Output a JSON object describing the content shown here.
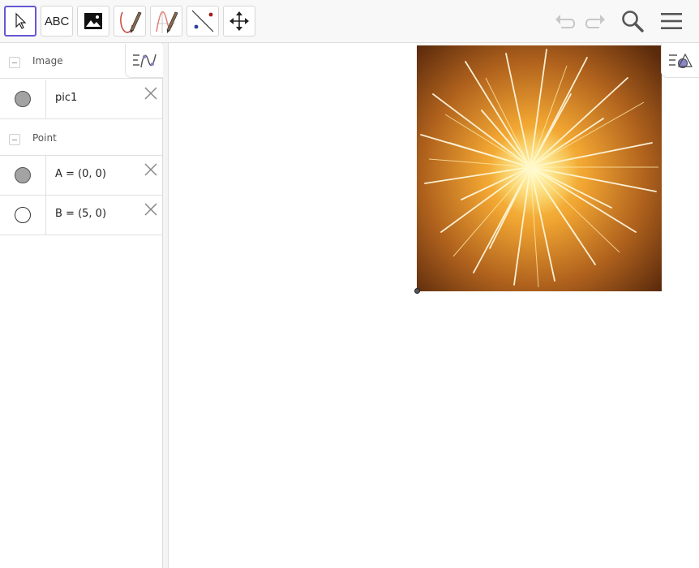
{
  "toolbar": {
    "tools": [
      {
        "name": "move-tool",
        "icon": "cursor-arrow-icon"
      },
      {
        "name": "text-tool",
        "label": "ABC"
      },
      {
        "name": "image-tool",
        "icon": "image-icon"
      },
      {
        "name": "pen-tool",
        "icon": "pen-icon"
      },
      {
        "name": "freehand-function-tool",
        "icon": "function-pen-icon"
      },
      {
        "name": "point-on-line-tool",
        "icon": "line-points-icon"
      },
      {
        "name": "move-graphics-view-tool",
        "icon": "move-arrows-icon"
      }
    ],
    "undo_icon": "undo-icon",
    "redo_icon": "redo-icon",
    "search_icon": "search-icon",
    "menu_icon": "hamburger-menu-icon",
    "accent_color": "#6557d2"
  },
  "algebra": {
    "groups": [
      {
        "label": "Image",
        "items": [
          {
            "text": "pic1",
            "marble": "filled"
          }
        ]
      },
      {
        "label": "Point",
        "items": [
          {
            "text": "A = (0, 0)",
            "marble": "filled"
          },
          {
            "text": "B = (5, 0)",
            "marble": "empty"
          }
        ]
      }
    ],
    "style_menu_icon": "algebra-style-icon"
  },
  "graphics": {
    "style_menu_icon": "graphics-style-icon",
    "picture_name": "pic1",
    "picture_subject": "fireworks"
  }
}
